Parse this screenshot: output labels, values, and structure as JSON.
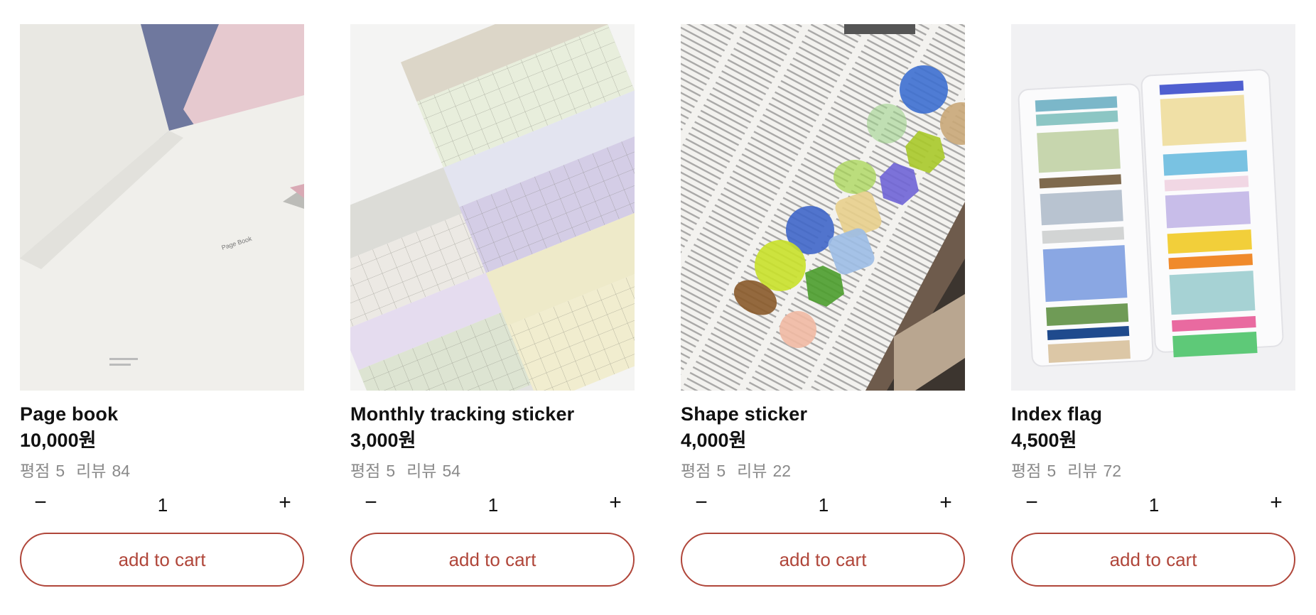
{
  "products": [
    {
      "name": "Page book",
      "price": "10,000원",
      "rating_label": "평점",
      "rating": "5",
      "review_label": "리뷰",
      "reviews": "84",
      "quantity": "1",
      "decrement": "−",
      "increment": "+",
      "cart_label": "add to cart",
      "image_icon": "notebook-image",
      "image_text": "Page\nBook"
    },
    {
      "name": "Monthly tracking sticker",
      "price": "3,000원",
      "rating_label": "평점",
      "rating": "5",
      "review_label": "리뷰",
      "reviews": "54",
      "quantity": "1",
      "decrement": "−",
      "increment": "+",
      "cart_label": "add to cart",
      "image_icon": "calendar-sticker-image"
    },
    {
      "name": "Shape sticker",
      "price": "4,000원",
      "rating_label": "평점",
      "rating": "5",
      "review_label": "리뷰",
      "reviews": "22",
      "quantity": "1",
      "decrement": "−",
      "increment": "+",
      "cart_label": "add to cart",
      "image_icon": "shape-sticker-image"
    },
    {
      "name": "Index flag",
      "price": "4,500원",
      "rating_label": "평점",
      "rating": "5",
      "review_label": "리뷰",
      "reviews": "72",
      "quantity": "1",
      "decrement": "−",
      "increment": "+",
      "cart_label": "add to cart",
      "image_icon": "index-flag-image"
    }
  ],
  "colors": {
    "accent": "#b0463a",
    "text": "#111111",
    "muted": "#8a8a8a"
  }
}
